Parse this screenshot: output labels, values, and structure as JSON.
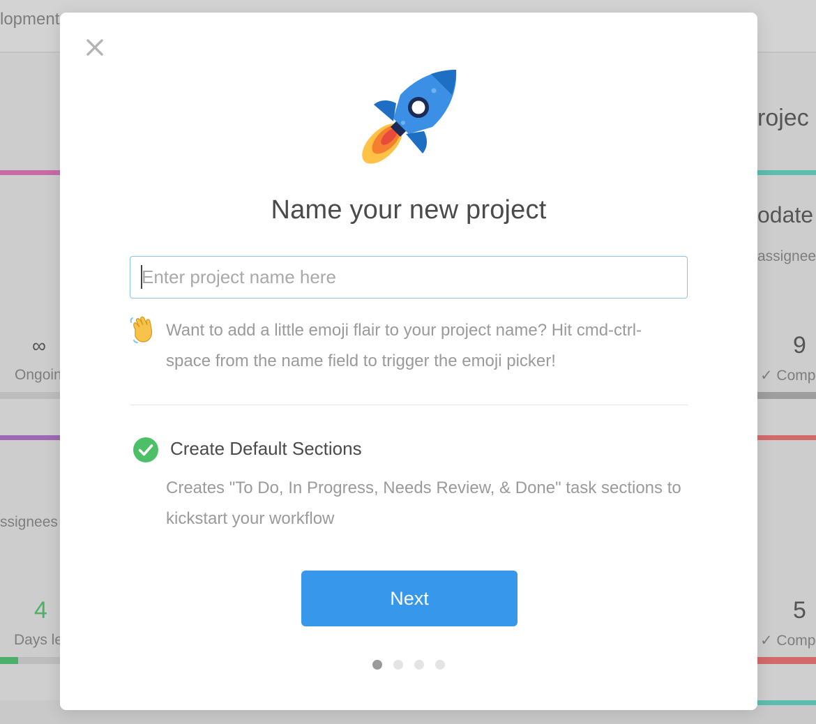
{
  "background": {
    "header_text": "lopment",
    "right_title": "rojec",
    "right_heading": "odate",
    "right_subtext": "assignee",
    "left_infinity": "∞",
    "left_ongoing": "Ongoin",
    "right_number_top": "9",
    "right_complete_top": "✓ Comp",
    "left_assignees": "ssignees",
    "left_number": "4",
    "left_days": "Days le",
    "right_number_bottom": "5",
    "right_complete_bottom": "✓ Comp",
    "colors": {
      "pink": "#c86aa6",
      "teal": "#5bbdb0",
      "purple": "#9c6ab4",
      "red": "#d36a6a",
      "green": "#4caf6a"
    }
  },
  "modal": {
    "close_icon": "close-icon",
    "rocket_icon": "rocket-icon",
    "title": "Name your new project",
    "input": {
      "placeholder": "Enter project name here",
      "value": ""
    },
    "tip": {
      "icon": "waving-hand-icon",
      "text": "Want to add a little emoji flair to your project name? Hit cmd-ctrl-space from the name field to trigger the emoji picker!"
    },
    "default_sections": {
      "checked": true,
      "icon": "check-circle-icon",
      "title": "Create Default Sections",
      "description": "Creates \"To Do, In Progress, Needs Review, & Done\" task sections to kickstart your workflow"
    },
    "next_label": "Next",
    "pager": {
      "total": 4,
      "active": 1
    },
    "accent_color": "#3797ea",
    "check_color": "#4cc067"
  }
}
